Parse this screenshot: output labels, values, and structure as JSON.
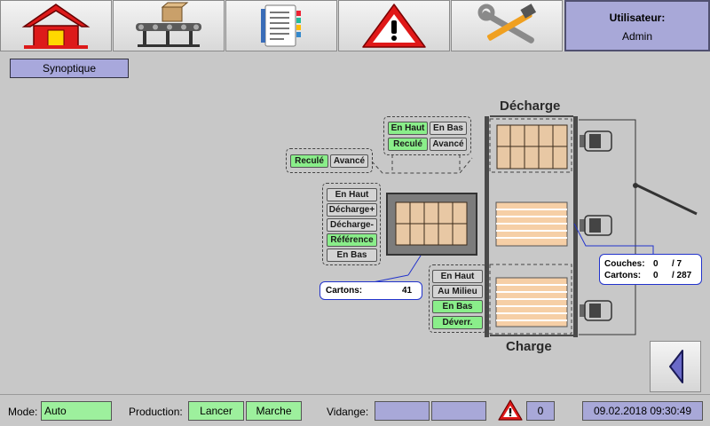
{
  "header": {
    "nav": [
      {
        "icon": "home-icon"
      },
      {
        "icon": "conveyor-icon"
      },
      {
        "icon": "document-list-icon"
      },
      {
        "icon": "warning-icon"
      },
      {
        "icon": "tools-icon"
      }
    ],
    "user_label": "Utilisateur:",
    "user_name": "Admin"
  },
  "screen_title": "Synoptique",
  "synoptic": {
    "decharge_label": "Décharge",
    "charge_label": "Charge",
    "top_group": {
      "en_haut": "En Haut",
      "en_bas": "En Bas",
      "recule": "Reculé",
      "avance": "Avancé"
    },
    "left_group": {
      "recule": "Reculé",
      "avance": "Avancé"
    },
    "gripper_group": {
      "en_haut": "En Haut",
      "decharge_plus": "Décharge+",
      "decharge_minus": "Décharge-",
      "reference": "Référence",
      "en_bas": "En Bas"
    },
    "lift_group": {
      "en_haut": "En Haut",
      "au_milieu": "Au Milieu",
      "en_bas": "En Bas",
      "deverr": "Déverr."
    },
    "cartons_info": {
      "label": "Cartons:",
      "value": "41"
    },
    "layers_info": {
      "couches_label": "Couches:",
      "couches_value": "0",
      "couches_total": "/ 7",
      "cartons_label": "Cartons:",
      "cartons_value": "0",
      "cartons_total": "/ 287"
    }
  },
  "footer": {
    "mode_label": "Mode:",
    "mode_value": "Auto",
    "production_label": "Production:",
    "lancer": "Lancer",
    "marche": "Marche",
    "vidange_label": "Vidange:",
    "alarm_count": "0",
    "datetime": "09.02.2018 09:30:49"
  },
  "colors": {
    "active_green": "#8aee8a",
    "panel_blue": "#a8a8d8",
    "alarm_red": "#e01818"
  }
}
